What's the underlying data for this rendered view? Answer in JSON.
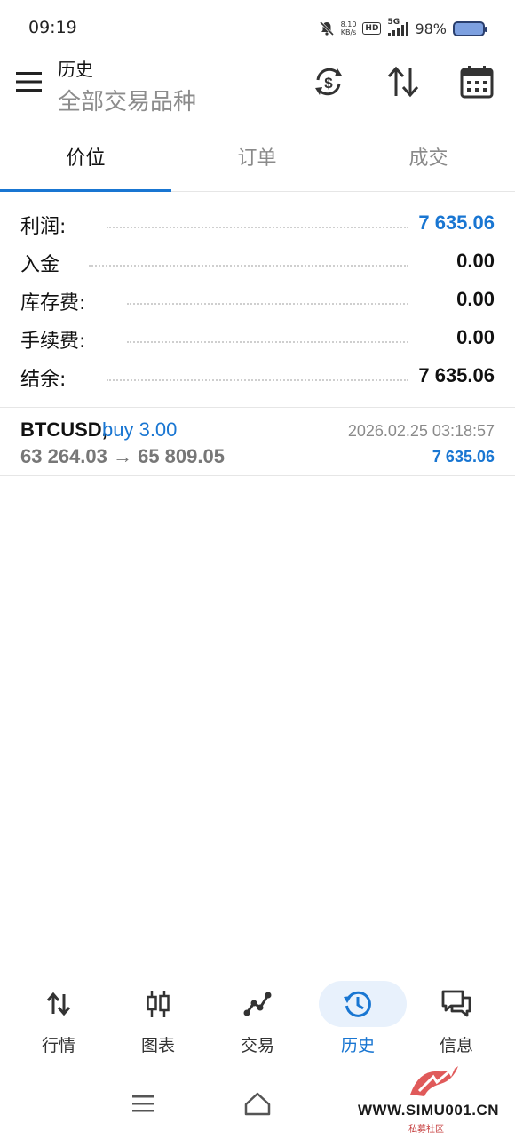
{
  "status_bar": {
    "time": "09:19",
    "net_speed_value": "8.10",
    "net_speed_unit": "KB/s",
    "hd_label": "HD",
    "network": "5G",
    "battery": "98%"
  },
  "header": {
    "title": "历史",
    "subtitle": "全部交易品种"
  },
  "tabs": [
    {
      "label": "价位",
      "active": true
    },
    {
      "label": "订单",
      "active": false
    },
    {
      "label": "成交",
      "active": false
    }
  ],
  "summary": [
    {
      "label": "利润:",
      "value": "7 635.06",
      "highlight": true
    },
    {
      "label": "入金",
      "value": "0.00",
      "highlight": false
    },
    {
      "label": "库存费:",
      "value": "0.00",
      "highlight": false
    },
    {
      "label": "手续费:",
      "value": "0.00",
      "highlight": false
    },
    {
      "label": "结余:",
      "value": "7 635.06",
      "highlight": false
    }
  ],
  "deal": {
    "symbol": "BTCUSD,",
    "type": "buy 3.00",
    "prices": "63 264.03 → 65 809.05",
    "time": "2026.02.25 03:18:57",
    "profit": "7 635.06"
  },
  "bottom_nav": [
    {
      "label": "行情",
      "icon": "quotes-arrows-icon",
      "active": false
    },
    {
      "label": "图表",
      "icon": "candlestick-chart-icon",
      "active": false
    },
    {
      "label": "交易",
      "icon": "trade-line-icon",
      "active": false
    },
    {
      "label": "历史",
      "icon": "history-clock-icon",
      "active": true
    },
    {
      "label": "信息",
      "icon": "messages-icon",
      "active": false
    }
  ],
  "watermark": {
    "text": "WWW.SIMU001.CN",
    "sub": "私募社区"
  },
  "colors": {
    "accent": "#1976d2",
    "muted": "#8a8a8a",
    "active_pill": "#e8f1fc"
  }
}
